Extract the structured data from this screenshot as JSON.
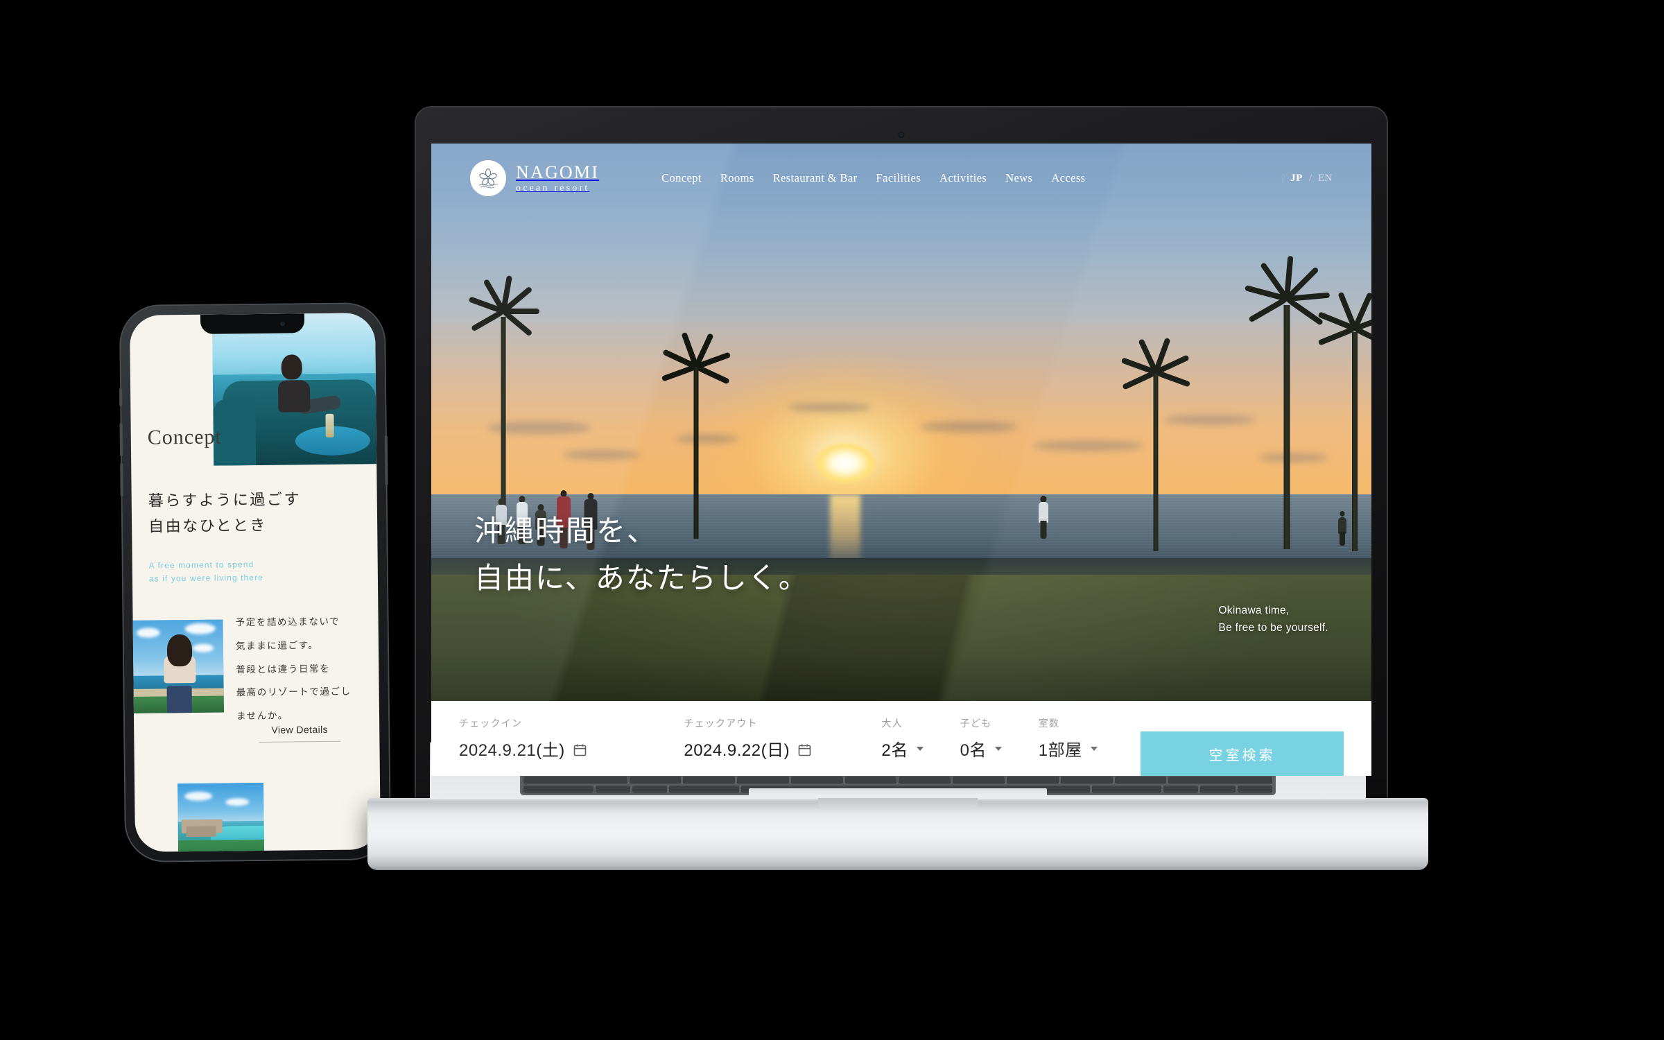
{
  "site": {
    "brand": {
      "name": "NAGOMI",
      "tagline": "ocean resort",
      "logo_icon": "plumeria-flower-icon"
    },
    "nav": [
      {
        "label": "Concept"
      },
      {
        "label": "Rooms"
      },
      {
        "label": "Restaurant & Bar"
      },
      {
        "label": "Facilities"
      },
      {
        "label": "Activities"
      },
      {
        "label": "News"
      },
      {
        "label": "Access"
      }
    ],
    "language": {
      "divider": "|",
      "slash": "/",
      "active": "JP",
      "inactive": "EN"
    },
    "hero": {
      "headline_line1": "沖縄時間を、",
      "headline_line2": "自由に、あなたらしく。",
      "english_line1": "Okinawa time,",
      "english_line2": "Be free to be yourself."
    },
    "booking": {
      "checkin": {
        "label": "チェックイン",
        "value": "2024.9.21(土)",
        "icon": "calendar-icon"
      },
      "checkout": {
        "label": "チェックアウト",
        "value": "2024.9.22(日)",
        "icon": "calendar-icon"
      },
      "adults": {
        "label": "大人",
        "value": "2名"
      },
      "children": {
        "label": "子ども",
        "value": "0名"
      },
      "rooms": {
        "label": "室数",
        "value": "1部屋"
      },
      "search_button": "空室検索",
      "accent_color": "#72d0e0"
    }
  },
  "phone": {
    "section_title": "Concept",
    "headline_line1": "暮らすように過ごす",
    "headline_line2": "自由なひととき",
    "sub_line1": "A free moment to spend",
    "sub_line2": "as if you were living there",
    "sub_color": "#7ecede",
    "body": [
      "予定を詰め込まないで",
      "気ままに過ごす。",
      "普段とは違う日常を",
      "最高のリゾートで過ごし",
      "ませんか。"
    ],
    "cta": "View Details"
  },
  "colors": {
    "accent": "#72d0e0",
    "phone_bg": "#f7f4ee",
    "text_dark": "#2d2c2a"
  }
}
